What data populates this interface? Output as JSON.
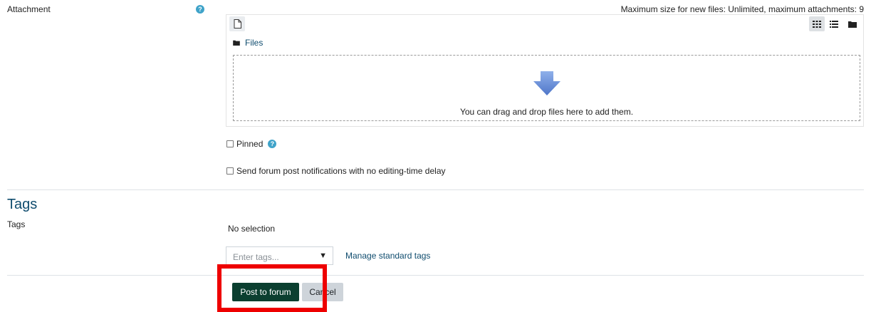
{
  "attachment": {
    "label": "Attachment",
    "help_glyph": "?",
    "max_size_text": "Maximum size for new files: Unlimited, maximum attachments: 9",
    "folder_label": "Files",
    "drop_text": "You can drag and drop files here to add them.",
    "arrow_color": "#6a8fd6"
  },
  "options": {
    "pinned_label": "Pinned",
    "pinned_help_glyph": "?",
    "notify_label": "Send forum post notifications with no editing-time delay"
  },
  "tags_section": {
    "heading": "Tags",
    "field_label": "Tags",
    "no_selection": "No selection",
    "input_placeholder": "Enter tags...",
    "manage_link": "Manage standard tags"
  },
  "actions": {
    "submit_label": "Post to forum",
    "cancel_label": "Cancel",
    "highlight_color": "#ee0000"
  },
  "colors": {
    "primary_button": "#0b3f30",
    "link": "#0f4c6e",
    "help_icon": "#3fa3c9"
  }
}
